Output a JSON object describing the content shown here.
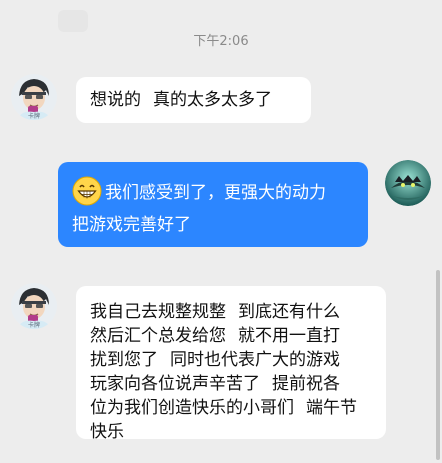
{
  "status": {
    "timestamp": "下午2:06"
  },
  "messages": [
    {
      "sender": "other",
      "lines": [
        "想说的",
        "真的太多太多了"
      ]
    },
    {
      "sender": "self",
      "emoji": "grinning-face-icon",
      "lines": [
        "我们感受到了，更强大的动力",
        "把游戏完善好了"
      ]
    },
    {
      "sender": "other",
      "lines": [
        "我自己去规整规整",
        "到底还有什么",
        "然后汇个总发给您",
        "就不用一直打",
        "扰到您了",
        "同时也代表广大的游戏",
        "玩家向各位说声辛苦了",
        "提前祝各",
        "位为我们创造快乐的小哥们",
        "端午节",
        "快乐"
      ]
    }
  ],
  "colors": {
    "background": "#ededed",
    "incoming_bubble": "#ffffff",
    "outgoing_bubble": "#2c86ff",
    "timestamp_text": "#8a8a8a"
  }
}
